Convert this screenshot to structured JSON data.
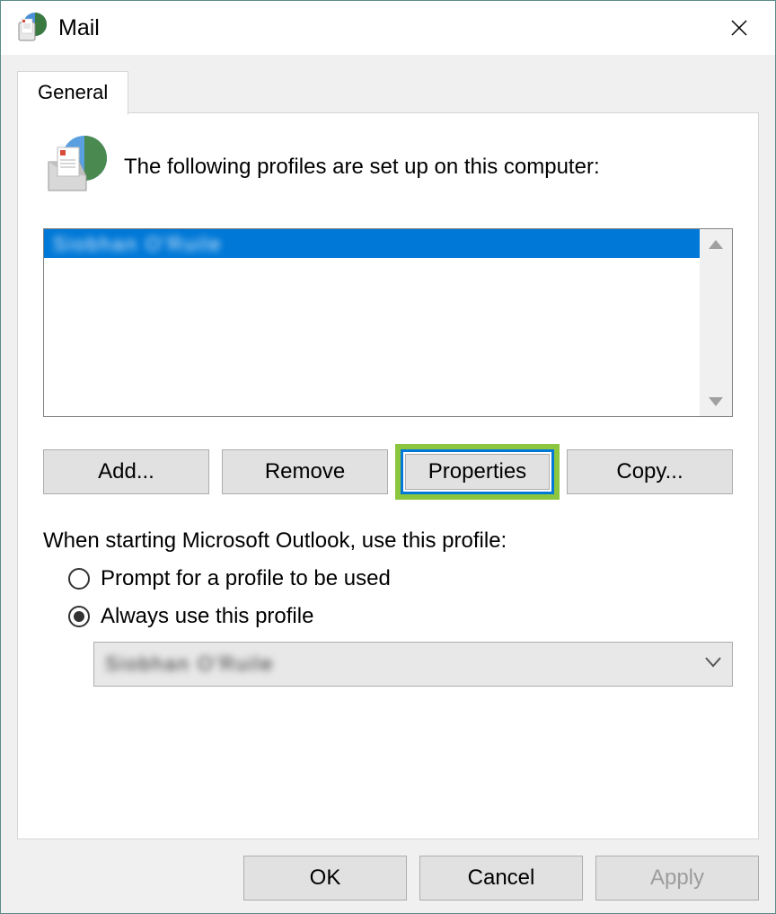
{
  "window": {
    "title": "Mail"
  },
  "tab": {
    "label": "General"
  },
  "intro": {
    "text": "The following profiles are set up on this computer:"
  },
  "profiles": {
    "selected": "Siobhan O'Ruile"
  },
  "buttons": {
    "add": "Add...",
    "remove": "Remove",
    "properties": "Properties",
    "copy": "Copy..."
  },
  "startup": {
    "label": "When starting Microsoft Outlook, use this profile:",
    "prompt": "Prompt for a profile to be used",
    "always": "Always use this profile",
    "selected_option": "always",
    "dropdown_value": "Siobhan O'Ruile"
  },
  "footer": {
    "ok": "OK",
    "cancel": "Cancel",
    "apply": "Apply"
  }
}
